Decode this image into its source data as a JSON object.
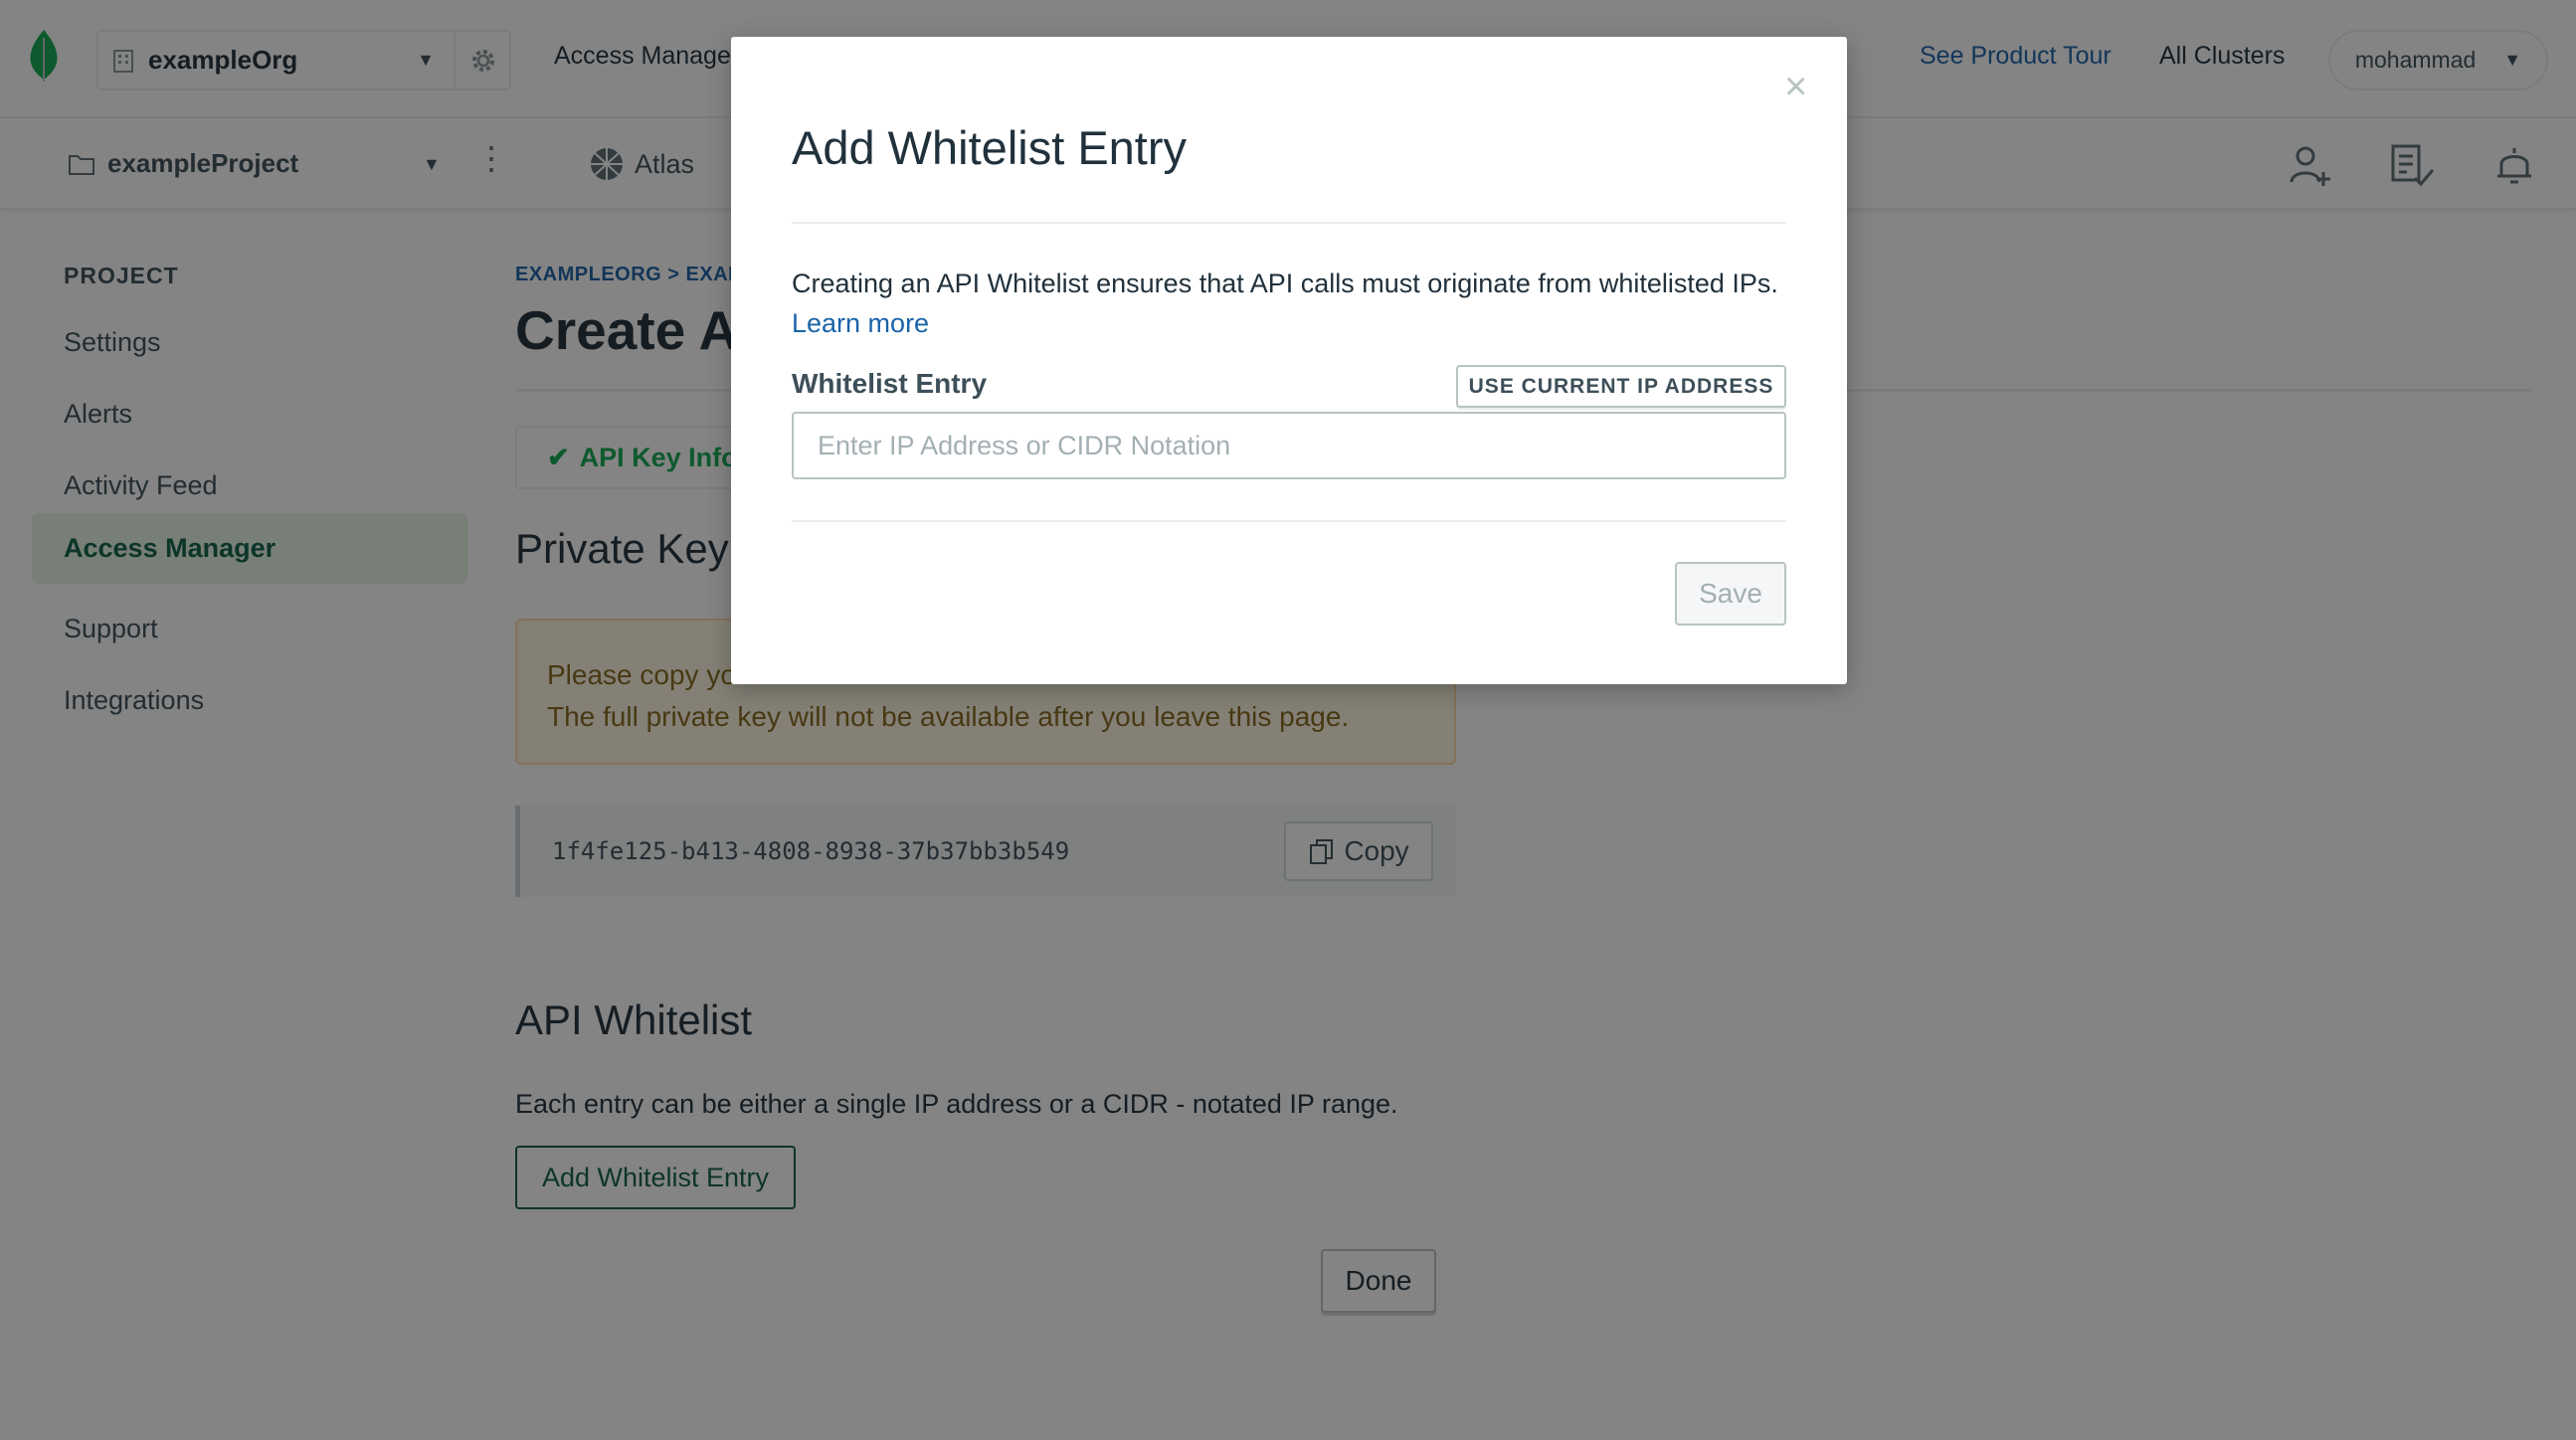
{
  "topbar": {
    "org_name": "exampleOrg",
    "access_manager_label": "Access Manager",
    "product_tour_label": "See Product Tour",
    "all_clusters_label": "All Clusters",
    "user_name": "mohammad"
  },
  "subbar": {
    "project_name": "exampleProject",
    "atlas_label": "Atlas"
  },
  "sidebar": {
    "heading": "PROJECT",
    "items": [
      {
        "label": "Settings"
      },
      {
        "label": "Alerts"
      },
      {
        "label": "Activity Feed"
      },
      {
        "label": "Access Manager"
      },
      {
        "label": "Support"
      },
      {
        "label": "Integrations"
      }
    ]
  },
  "main": {
    "breadcrumb": "EXAMPLEORG > EXAM",
    "title": "Create AP",
    "step_tab": "API Key Info",
    "private_key_heading": "Private Key",
    "warning_line1": "Please copy yo",
    "warning_line2": "The full private key will not be available after you leave this page.",
    "private_key": "1f4fe125-b413-4808-8938-37b37bb3b549",
    "copy_label": "Copy",
    "whitelist_heading": "API Whitelist",
    "whitelist_description": "Each entry can be either a single IP address or a CIDR - notated IP range.",
    "add_entry_label": "Add Whitelist Entry",
    "done_label": "Done"
  },
  "modal": {
    "title": "Add Whitelist Entry",
    "description": "Creating an API Whitelist ensures that API calls must originate from whitelisted IPs.",
    "learn_more": "Learn more",
    "field_label": "Whitelist Entry",
    "use_current_ip_label": "USE CURRENT IP ADDRESS",
    "input_placeholder": "Enter IP Address or CIDR Notation",
    "input_value": "",
    "save_label": "Save",
    "close_symbol": "×"
  },
  "colors": {
    "brand_green": "#13aa52",
    "dark_green": "#116149",
    "link_blue": "#1a63a8"
  }
}
